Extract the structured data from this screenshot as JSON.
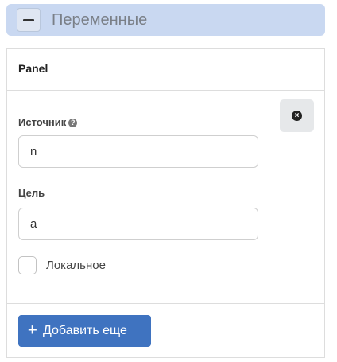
{
  "section": {
    "title": "Переменные",
    "collapse_icon": "minus-icon"
  },
  "table": {
    "column_header": "Panel",
    "source_label": "Источник",
    "source_help_icon": "question-circle-icon",
    "source_help_glyph": "?",
    "source_value": "n",
    "target_label": "Цель",
    "target_value": "a",
    "local_label": "Локальное",
    "local_checked": false,
    "remove_icon": "times-circle-icon",
    "remove_glyph": "×"
  },
  "actions": {
    "add_icon": "plus-icon",
    "add_glyph": "+",
    "add_label": "Добавить еще"
  },
  "colors": {
    "header_bg": "#c9d8f1",
    "primary_button": "#3f73c0"
  }
}
